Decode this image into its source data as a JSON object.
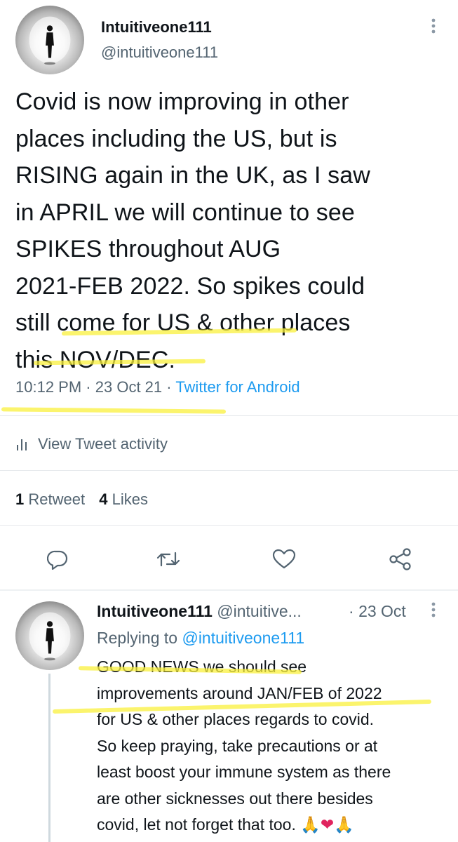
{
  "main_tweet": {
    "display_name": "Intuitiveone111",
    "handle": "@intuitiveone111",
    "text_lines": [
      "Covid is now improving in other",
      "places including the US, but is",
      "RISING again in the UK, as I saw",
      "in APRIL we will continue to see",
      "SPIKES throughout AUG",
      "2021-FEB 2022. So spikes could",
      "still come for US & other places",
      "this NOV/DEC."
    ],
    "time": "10:12 PM",
    "date": "23 Oct 21",
    "separator": "·",
    "source": "Twitter for Android",
    "activity_label": "View Tweet activity",
    "retweet_count": "1",
    "retweet_label": "Retweet",
    "like_count": "4",
    "like_label": "Likes"
  },
  "actions": {
    "reply_icon": "speech-bubble-icon",
    "retweet_icon": "retweet-arrows-icon",
    "like_icon": "heart-icon",
    "share_icon": "share-nodes-icon"
  },
  "reply_tweet": {
    "display_name": "Intuitiveone111",
    "handle": "@intuitive...",
    "separator": "·",
    "date": "23 Oct",
    "replying_prefix": "Replying to",
    "replying_to": "@intuitiveone111",
    "text_lines": [
      "GOOD NEWS we should see",
      "improvements around JAN/FEB of 2022",
      "for US & other places regards to covid.",
      "So keep praying, take precautions or at",
      "least boost your immune system as there",
      "are other sicknesses out there besides",
      "covid, let not forget that too."
    ],
    "emojis": "🙏❤🙏"
  },
  "colors": {
    "text": "#0f1419",
    "secondary": "#536471",
    "link": "#1d9bf0",
    "highlighter": "#f5e93a",
    "heart_emoji": "#e0245e"
  }
}
